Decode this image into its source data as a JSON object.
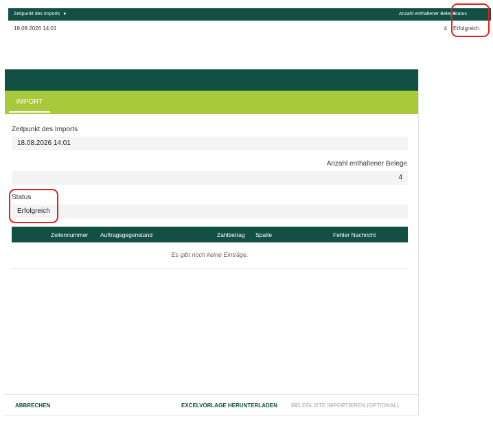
{
  "list": {
    "columns": {
      "date": "Zeitpunkt des Imports",
      "count": "Anzahl enthaltener Belege",
      "status": "Status"
    },
    "rows": [
      {
        "date": "18.08.2026 14:01",
        "count": "4",
        "status": "Erfolgreich"
      }
    ]
  },
  "dialog": {
    "tab_label": "IMPORT",
    "date_label": "Zeitpunkt des Imports",
    "date_value": "18.08.2026 14:01",
    "count_label": "Anzahl enthaltener Belege",
    "count_value": "4",
    "status_label": "Status",
    "status_value": "Erfolgreich",
    "grid": {
      "columns": [
        "Zeilennummer",
        "Auftragsgegenstand",
        "Zahlbetrag",
        "Spalte",
        "Fehler Nachricht"
      ],
      "empty_text": "Es gibt noch keine Einträge."
    },
    "footer": {
      "cancel": "ABBRECHEN",
      "download_template": "EXCELVORLAGE HERUNTERLADEN",
      "import_list": "BELEGLISTE IMPORTIEREN (OPTIONAL)"
    }
  },
  "colors": {
    "primary": "#124f45",
    "accent": "#a8c93a",
    "highlight": "#e0201c"
  }
}
